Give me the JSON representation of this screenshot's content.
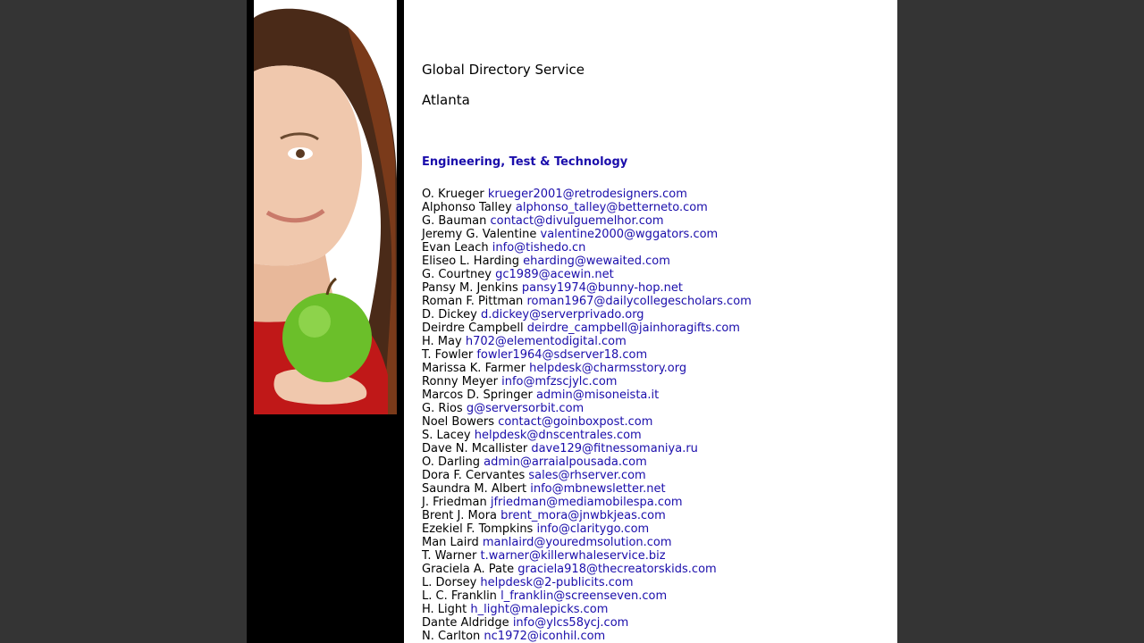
{
  "title": "Global Directory Service",
  "city": "Atlanta",
  "section": "Engineering, Test & Technology",
  "contacts": [
    {
      "name": "O. Krueger",
      "email": "krueger2001@retrodesigners.com"
    },
    {
      "name": "Alphonso Talley",
      "email": "alphonso_talley@betterneto.com"
    },
    {
      "name": "G. Bauman",
      "email": "contact@divulguemelhor.com"
    },
    {
      "name": "Jeremy G. Valentine",
      "email": "valentine2000@wggators.com"
    },
    {
      "name": "Evan Leach",
      "email": "info@tishedo.cn"
    },
    {
      "name": "Eliseo L. Harding",
      "email": "eharding@wewaited.com"
    },
    {
      "name": "G. Courtney",
      "email": "gc1989@acewin.net"
    },
    {
      "name": "Pansy M. Jenkins",
      "email": "pansy1974@bunny-hop.net"
    },
    {
      "name": "Roman F. Pittman",
      "email": "roman1967@dailycollegescholars.com"
    },
    {
      "name": "D. Dickey",
      "email": "d.dickey@serverprivado.org"
    },
    {
      "name": "Deirdre Campbell",
      "email": "deirdre_campbell@jainhoragifts.com"
    },
    {
      "name": "H. May",
      "email": "h702@elementodigital.com"
    },
    {
      "name": "T. Fowler",
      "email": "fowler1964@sdserver18.com"
    },
    {
      "name": "Marissa K. Farmer",
      "email": "helpdesk@charmsstory.org"
    },
    {
      "name": "Ronny Meyer",
      "email": "info@mfzscjylc.com"
    },
    {
      "name": "Marcos D. Springer",
      "email": "admin@misoneista.it"
    },
    {
      "name": "G. Rios",
      "email": "g@serversorbit.com"
    },
    {
      "name": "Noel Bowers",
      "email": "contact@goinboxpost.com"
    },
    {
      "name": "S. Lacey",
      "email": "helpdesk@dnscentrales.com"
    },
    {
      "name": "Dave N. Mcallister",
      "email": "dave129@fitnessomaniya.ru"
    },
    {
      "name": "O. Darling",
      "email": "admin@arraialpousada.com"
    },
    {
      "name": "Dora F. Cervantes",
      "email": "sales@rhserver.com"
    },
    {
      "name": "Saundra M. Albert",
      "email": "info@mbnewsletter.net"
    },
    {
      "name": "J. Friedman",
      "email": "jfriedman@mediamobilespa.com"
    },
    {
      "name": "Brent J. Mora",
      "email": "brent_mora@jnwbkjeas.com"
    },
    {
      "name": "Ezekiel F. Tompkins",
      "email": "info@claritygo.com"
    },
    {
      "name": "Man Laird",
      "email": "manlaird@youredmsolution.com"
    },
    {
      "name": "T. Warner",
      "email": "t.warner@killerwhaleservice.biz"
    },
    {
      "name": "Graciela A. Pate",
      "email": "graciela918@thecreatorskids.com"
    },
    {
      "name": "L. Dorsey",
      "email": "helpdesk@2-publicits.com"
    },
    {
      "name": "L. C. Franklin",
      "email": "l_franklin@screenseven.com"
    },
    {
      "name": "H. Light",
      "email": "h_light@malepicks.com"
    },
    {
      "name": "Dante Aldridge",
      "email": "info@ylcs58ycj.com"
    },
    {
      "name": "N. Carlton",
      "email": "nc1972@iconhil.com"
    }
  ]
}
